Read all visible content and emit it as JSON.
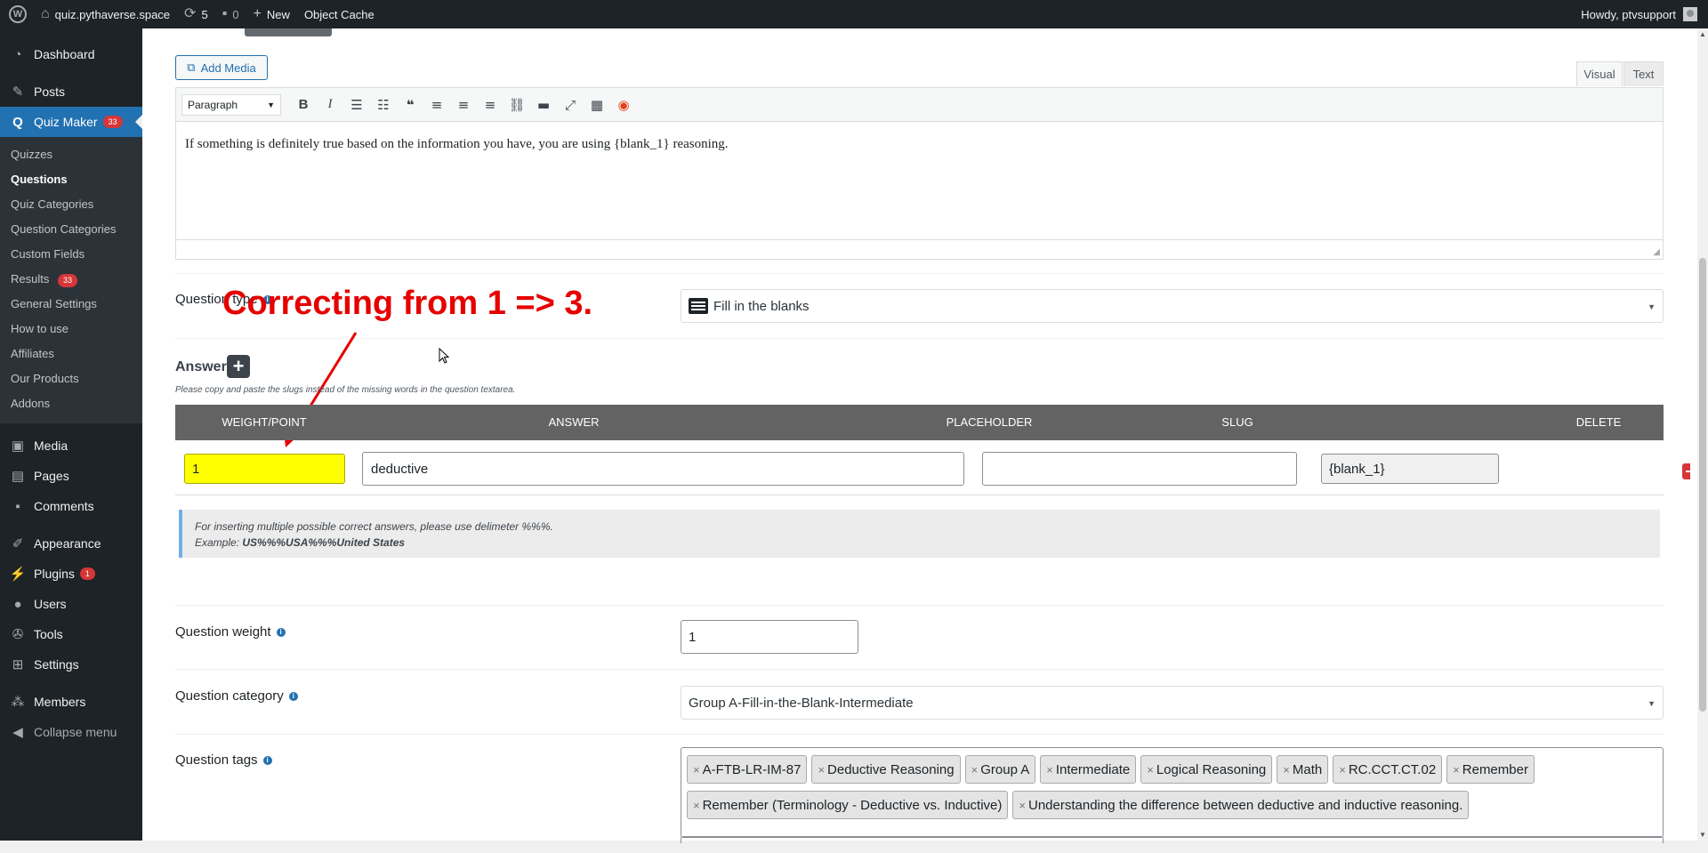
{
  "adminbar": {
    "site_name": "quiz.pythaverse.space",
    "updates_count": "5",
    "comments_count": "0",
    "new_label": "New",
    "object_cache": "Object Cache",
    "howdy": "Howdy, ptvsupport"
  },
  "sidebar": {
    "dashboard": "Dashboard",
    "posts": "Posts",
    "quiz_maker": "Quiz Maker",
    "quiz_maker_badge": "33",
    "submenu": {
      "quizzes": "Quizzes",
      "questions": "Questions",
      "quiz_categories": "Quiz Categories",
      "question_categories": "Question Categories",
      "custom_fields": "Custom Fields",
      "results": "Results",
      "results_badge": "33",
      "general_settings": "General Settings",
      "how_to_use": "How to use",
      "affiliates": "Affiliates",
      "our_products": "Our Products",
      "addons": "Addons"
    },
    "media": "Media",
    "pages": "Pages",
    "comments": "Comments",
    "appearance": "Appearance",
    "plugins": "Plugins",
    "plugins_badge": "1",
    "users": "Users",
    "tools": "Tools",
    "settings": "Settings",
    "members": "Members",
    "collapse": "Collapse menu"
  },
  "editor": {
    "add_media": "Add Media",
    "tab_visual": "Visual",
    "tab_text": "Text",
    "format": "Paragraph",
    "content": "If something is definitely true based on the information you have, you are using {blank_1} reasoning."
  },
  "question_type": {
    "label": "Question type",
    "value": "Fill in the blanks"
  },
  "annotation": "Correcting from 1 => 3.",
  "answer": {
    "label": "Answer",
    "hint": "Please copy and paste the slugs instead of the missing words in the question textarea.",
    "headers": [
      "WEIGHT/POINT",
      "ANSWER",
      "PLACEHOLDER",
      "SLUG",
      "DELETE"
    ],
    "row": {
      "weight": "1",
      "answer": "deductive",
      "placeholder": "",
      "slug": "{blank_1}"
    },
    "notice_line1": "For inserting multiple possible correct answers, please use delimeter %%%.",
    "notice_example_prefix": "Example: ",
    "notice_example": "US%%%USA%%%United States"
  },
  "question_weight": {
    "label": "Question weight",
    "value": "1"
  },
  "question_category": {
    "label": "Question category",
    "value": "Group A-Fill-in-the-Blank-Intermediate"
  },
  "question_tags": {
    "label": "Question tags",
    "tags": [
      "A-FTB-LR-IM-87",
      "Deductive Reasoning",
      "Group A",
      "Intermediate",
      "Logical Reasoning",
      "Math",
      "RC.CCT.CT.02",
      "Remember",
      "Remember (Terminology - Deductive vs. Inductive)",
      "Understanding the difference between deductive and inductive reasoning."
    ]
  },
  "colors": {
    "wp_blue": "#2271b1",
    "admin_dark": "#1d2327",
    "annotation_red": "#e60000",
    "highlight_yellow": "#ffff00"
  }
}
